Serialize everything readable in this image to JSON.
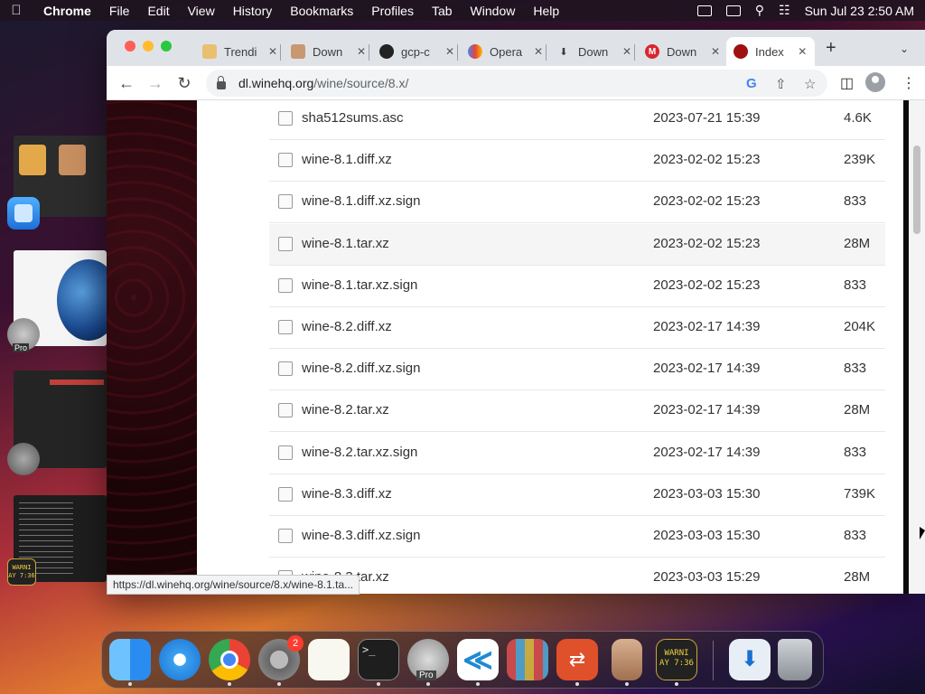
{
  "menubar": {
    "app_name": "Chrome",
    "items": [
      "File",
      "Edit",
      "View",
      "History",
      "Bookmarks",
      "Profiles",
      "Tab",
      "Window",
      "Help"
    ],
    "clock": "Sun Jul 23  2:50 AM"
  },
  "stage_manager": {
    "warning_app_label": "WARNI\nAY 7:36",
    "pro_label": "Pro"
  },
  "tabs": [
    {
      "title": "Trendi",
      "icon": "trend-favicon"
    },
    {
      "title": "Down",
      "icon": "wine-favicon"
    },
    {
      "title": "gcp-c",
      "icon": "github-favicon"
    },
    {
      "title": "Opera",
      "icon": "google-cloud-favicon"
    },
    {
      "title": "Down",
      "icon": "download-favicon"
    },
    {
      "title": "Down",
      "icon": "mega-favicon"
    },
    {
      "title": "Index",
      "icon": "winehq-favicon",
      "active": true
    }
  ],
  "address_bar": {
    "host": "dl.winehq.org",
    "path": "/wine/source/8.x/"
  },
  "files": [
    {
      "name": "sha512sums.asc",
      "date": "2023-07-21 15:39",
      "size": "4.6K"
    },
    {
      "name": "wine-8.1.diff.xz",
      "date": "2023-02-02 15:23",
      "size": "239K"
    },
    {
      "name": "wine-8.1.diff.xz.sign",
      "date": "2023-02-02 15:23",
      "size": "833"
    },
    {
      "name": "wine-8.1.tar.xz",
      "date": "2023-02-02 15:23",
      "size": "28M",
      "hover": true
    },
    {
      "name": "wine-8.1.tar.xz.sign",
      "date": "2023-02-02 15:23",
      "size": "833"
    },
    {
      "name": "wine-8.2.diff.xz",
      "date": "2023-02-17 14:39",
      "size": "204K"
    },
    {
      "name": "wine-8.2.diff.xz.sign",
      "date": "2023-02-17 14:39",
      "size": "833"
    },
    {
      "name": "wine-8.2.tar.xz",
      "date": "2023-02-17 14:39",
      "size": "28M"
    },
    {
      "name": "wine-8.2.tar.xz.sign",
      "date": "2023-02-17 14:39",
      "size": "833"
    },
    {
      "name": "wine-8.3.diff.xz",
      "date": "2023-03-03 15:30",
      "size": "739K"
    },
    {
      "name": "wine-8.3.diff.xz.sign",
      "date": "2023-03-03 15:30",
      "size": "833"
    },
    {
      "name": "wine-8.3.tar.xz",
      "date": "2023-03-03 15:29",
      "size": "28M"
    }
  ],
  "status_url": "https://dl.winehq.org/wine/source/8.x/wine-8.1.ta...",
  "dock": {
    "apps": [
      {
        "name": "Finder",
        "icon": "finder-icon",
        "running": true
      },
      {
        "name": "Safari",
        "icon": "safari-icon",
        "running": false
      },
      {
        "name": "Google Chrome",
        "icon": "chrome-icon",
        "running": true
      },
      {
        "name": "System Settings",
        "icon": "settings-icon",
        "running": true,
        "badge": "2"
      },
      {
        "name": "TextEdit",
        "icon": "textedit-icon",
        "running": false
      },
      {
        "name": "Terminal",
        "icon": "terminal-icon",
        "running": true
      },
      {
        "name": "Google Earth Pro",
        "icon": "google-earth-icon",
        "running": true,
        "label": "Pro"
      },
      {
        "name": "Visual Studio Code",
        "icon": "vscode-icon",
        "running": true
      },
      {
        "name": "Launchpad",
        "icon": "launchpad-icon",
        "running": false
      },
      {
        "name": "Remote Desktop",
        "icon": "remote-desktop-icon",
        "running": true
      },
      {
        "name": "Wine",
        "icon": "wine-bottle-icon",
        "running": true
      },
      {
        "name": "Console",
        "icon": "console-warning-icon",
        "running": true,
        "label": "WARNI\nAY 7:36"
      }
    ],
    "downloads_icon": "downloads-stack-icon",
    "trash_icon": "trash-icon"
  }
}
